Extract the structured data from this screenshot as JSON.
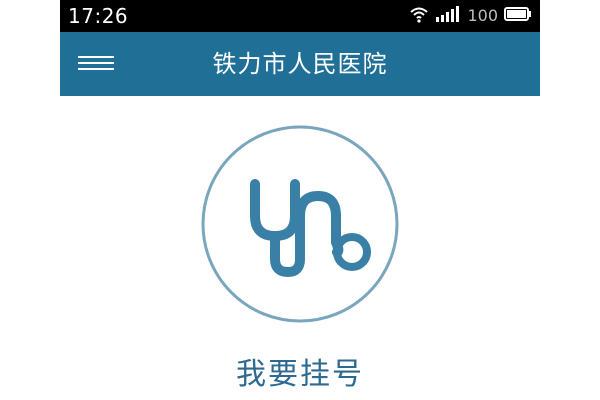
{
  "status_bar": {
    "time": "17:26",
    "battery_percent": "100",
    "icons": [
      "wifi-icon",
      "signal-icon",
      "battery-icon"
    ]
  },
  "header": {
    "title": "铁力市人民医院",
    "menu_icon": "hamburger-menu-icon"
  },
  "main": {
    "action_icon": "stethoscope-icon",
    "action_label": "我要挂号"
  },
  "colors": {
    "header_bg": "#1f6f97",
    "accent": "#2c6a8f",
    "circle": "#7aa6bd",
    "icon": "#3a7fa6"
  }
}
